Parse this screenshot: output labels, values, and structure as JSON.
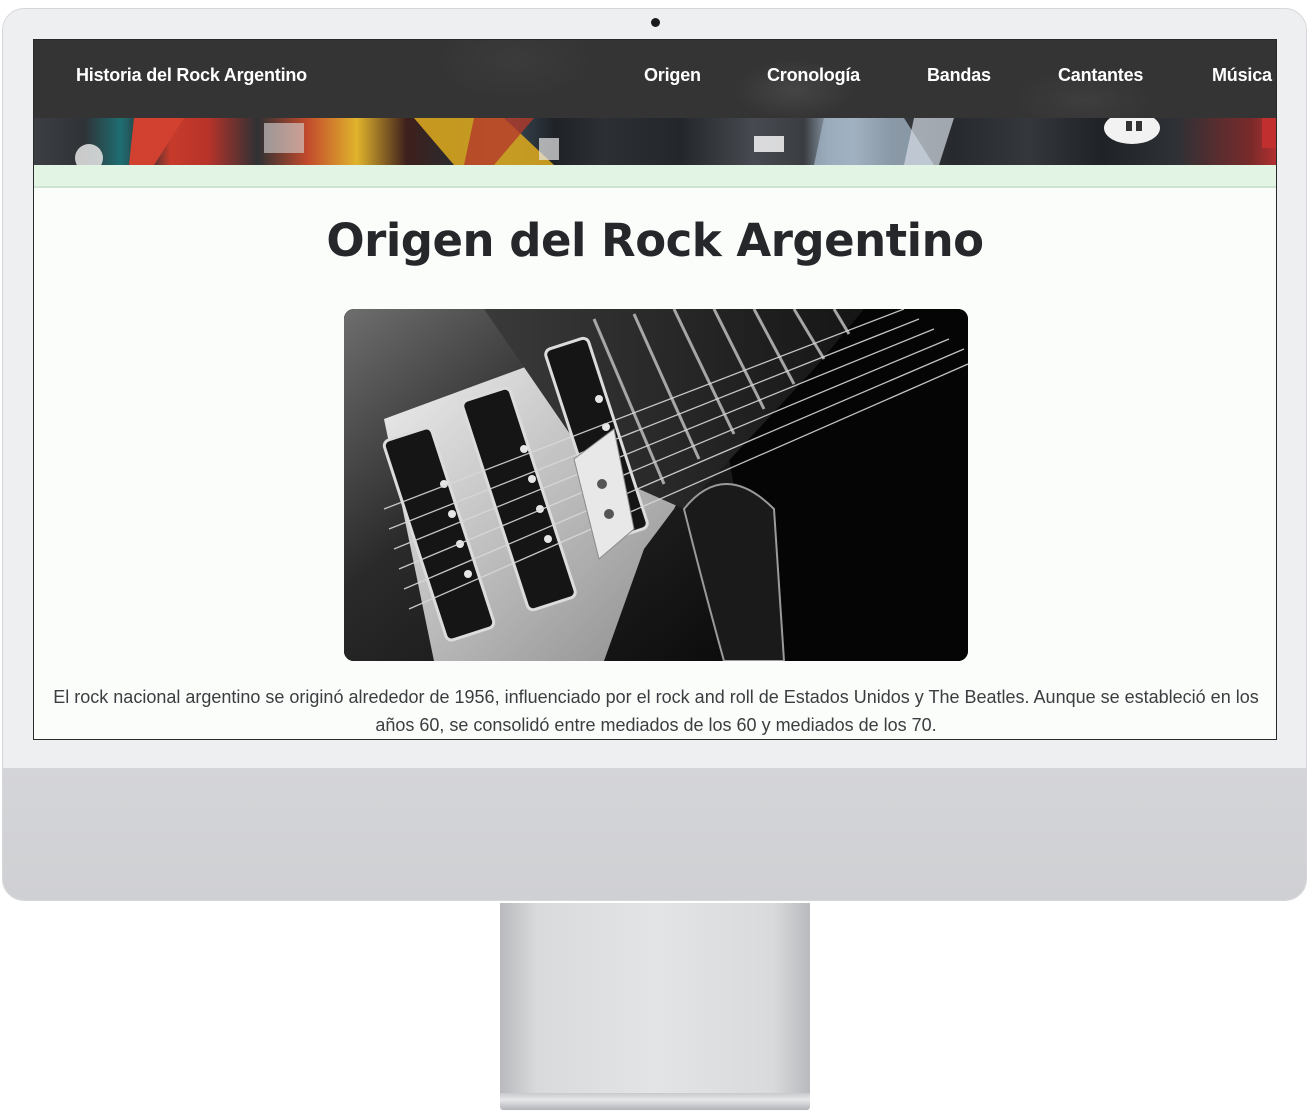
{
  "site": {
    "brand": "Historia del Rock Argentino"
  },
  "nav": {
    "links": [
      {
        "label": "Origen"
      },
      {
        "label": "Cronología"
      },
      {
        "label": "Bandas"
      },
      {
        "label": "Cantantes"
      },
      {
        "label": "Música"
      }
    ]
  },
  "main": {
    "title": "Origen del Rock Argentino",
    "intro": "El rock nacional argentino se originó alrededor de 1956, influenciado por el rock and roll de Estados Unidos y The Beatles. Aunque se estableció en los años 60, se consolidó entre mediados de los 60 y mediados de los 70."
  },
  "colors": {
    "navbar_bg": "#343434",
    "accent_strip": "#e2f4e4",
    "page_bg": "#fbfdfb",
    "heading_text": "#25272b"
  }
}
